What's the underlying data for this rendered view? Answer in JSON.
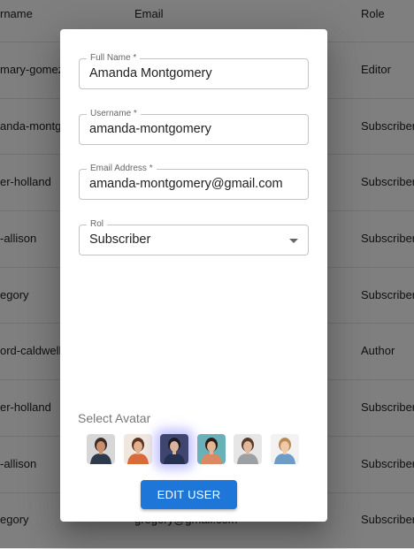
{
  "table": {
    "headers": {
      "username": "rname",
      "email": "Email",
      "role": "Role"
    },
    "rows": [
      {
        "username": "mary-gomez",
        "email": "",
        "role": "Editor"
      },
      {
        "username": "anda-montgo",
        "email": "",
        "role": "Subscriber"
      },
      {
        "username": "er-holland",
        "email": "",
        "role": "Subscriber"
      },
      {
        "username": "-allison",
        "email": "",
        "role": "Subscriber"
      },
      {
        "username": "egory",
        "email": "",
        "role": "Subscriber"
      },
      {
        "username": "ord-caldwell",
        "email": "",
        "role": "Author"
      },
      {
        "username": "er-holland",
        "email": "",
        "role": "Subscriber"
      },
      {
        "username": "-allison",
        "email": "",
        "role": "Subscriber"
      },
      {
        "username": "egory",
        "email": "gregory@gmail.com",
        "role": "Subscriber"
      }
    ]
  },
  "dialog": {
    "full_name": {
      "label": "Full Name *",
      "value": "Amanda Montgomery"
    },
    "username": {
      "label": "Username *",
      "value": "amanda-montgomery"
    },
    "email": {
      "label": "Email Address *",
      "value": "amanda-montgomery@gmail.com"
    },
    "role": {
      "label": "Rol",
      "value": "Subscriber"
    },
    "avatar_title": "Select Avatar",
    "avatars": [
      {
        "icon": "avatar-1",
        "bg": "#d7d7d7",
        "skin": "#c9906d",
        "hair": "#3a2c24",
        "shirt": "#2e3a4a"
      },
      {
        "icon": "avatar-2",
        "bg": "#f0e8df",
        "skin": "#e3b08f",
        "hair": "#5b3320",
        "shirt": "#d96a3a"
      },
      {
        "icon": "avatar-3",
        "bg": "#3e4670",
        "skin": "#d8b49b",
        "hair": "#1f1a26",
        "shirt": "#263150"
      },
      {
        "icon": "avatar-4",
        "bg": "#6ab0b8",
        "skin": "#e2b692",
        "hair": "#2b1c16",
        "shirt": "#d98a63"
      },
      {
        "icon": "avatar-5",
        "bg": "#e6e6e6",
        "skin": "#e0b89c",
        "hair": "#5a3b27",
        "shirt": "#9aa0a4"
      },
      {
        "icon": "avatar-6",
        "bg": "#f2f2f2",
        "skin": "#f0c9a8",
        "hair": "#b98b54",
        "shirt": "#6f9cc6"
      }
    ],
    "selected_avatar": 2,
    "submit_label": "EDIT USER",
    "accent": "#1e77d8"
  }
}
